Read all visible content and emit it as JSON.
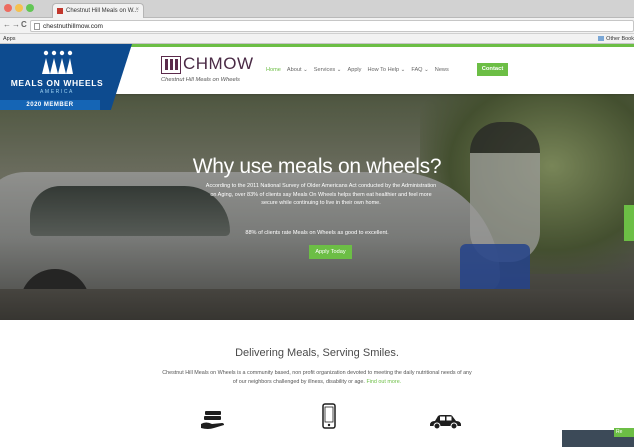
{
  "browser": {
    "tab_title": "Chestnut Hill Meals on W...",
    "tab_close": "×",
    "url": "chestnuthillmow.com",
    "back": "←",
    "forward": "→",
    "reload": "C",
    "apps_label": "Apps",
    "other_bookmarks": "Other Book",
    "traffic_lights": [
      "#ed6b5f",
      "#f5c14f",
      "#62c655"
    ]
  },
  "badge": {
    "logo_text": "MEALS ON WHEELS",
    "logo_sub": "AMERICA",
    "member_label": "2020 MEMBER"
  },
  "site": {
    "logo_text": "CHMOW",
    "tagline": "Chestnut Hill Meals on Wheels",
    "nav": [
      {
        "label": "Home"
      },
      {
        "label": "About ⌄"
      },
      {
        "label": "Services ⌄"
      },
      {
        "label": "Apply"
      },
      {
        "label": "How To Help ⌄"
      },
      {
        "label": "FAQ ⌄"
      },
      {
        "label": "News"
      }
    ],
    "contact_label": "Contact",
    "accent_color": "#6cbe45"
  },
  "hero": {
    "title": "Why use meals on wheels?",
    "text": "According to the 2011 National Survey of Older Americans Act conducted by the Administration on Aging, over 83% of clients say Meals On Wheels helps them eat healthier and feel more secure while continuing to live in their own home.",
    "stat": "88% of clients rate Meals on Wheels as good to excellent.",
    "cta": "Apply Today"
  },
  "section": {
    "heading": "Delivering Meals, Serving Smiles.",
    "description": "Chestnut Hill Meals on Wheels is a community based, non profit organization devoted to meeting the daily nutritional needs of any of our neighbors challenged by illness, disability or age.",
    "more_link": "Find out more.",
    "icons": [
      "money-icon",
      "phone-icon",
      "car-icon"
    ]
  },
  "widget": {
    "label": "Re"
  }
}
